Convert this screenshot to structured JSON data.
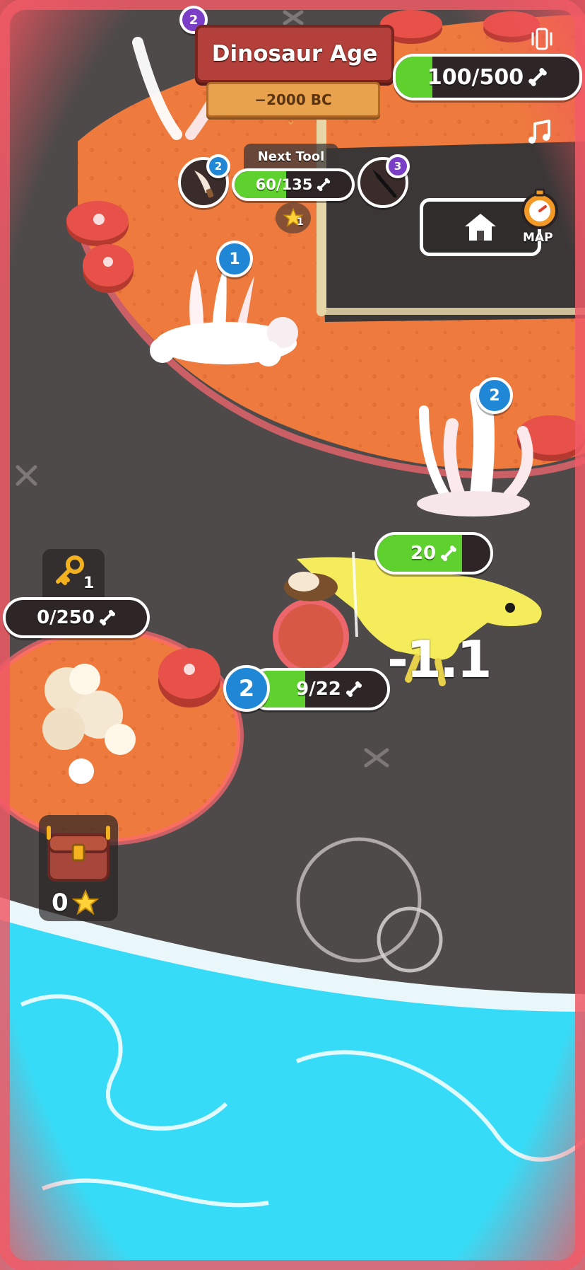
{
  "header": {
    "title": "Dinosaur Age",
    "era": "−2000 BC"
  },
  "resource": {
    "bones_text": "100/500",
    "progress": 0.2
  },
  "next_tool": {
    "label": "Next Tool",
    "progress_text": "60/135",
    "progress": 0.44,
    "current_level": "2",
    "next_level": "3",
    "star_reward": "1",
    "current_icon": "stone-knife-icon",
    "next_icon": "spear-icon"
  },
  "top_badge": "2",
  "map_button": {
    "label": "MAP",
    "icon": "stopwatch-icon"
  },
  "home_button": {
    "icon": "home-icon"
  },
  "settings": {
    "vibration_icon": "vibration-icon",
    "music_icon": "music-note-icon"
  },
  "bone_piles": [
    {
      "level": "1"
    },
    {
      "level": "2"
    }
  ],
  "enemy": {
    "hp_text": "20",
    "hp_progress": 0.75,
    "damage_text": "-1.1"
  },
  "player": {
    "level": "2",
    "xp_text": "9/22",
    "xp_progress": 0.4
  },
  "key_unlock": {
    "key_count": "1",
    "progress_text": "0/250",
    "progress": 0
  },
  "chest": {
    "stars": "0",
    "icon": "treasure-chest-icon"
  },
  "colors": {
    "vignette": "#f0555f",
    "orange_ground": "#ee7a3e",
    "rock": "#4f4a4a",
    "water": "#36dcf7",
    "progress_green": "#5fd12e",
    "badge_blue": "#1f87d6",
    "badge_purple": "#7a3ec7"
  }
}
